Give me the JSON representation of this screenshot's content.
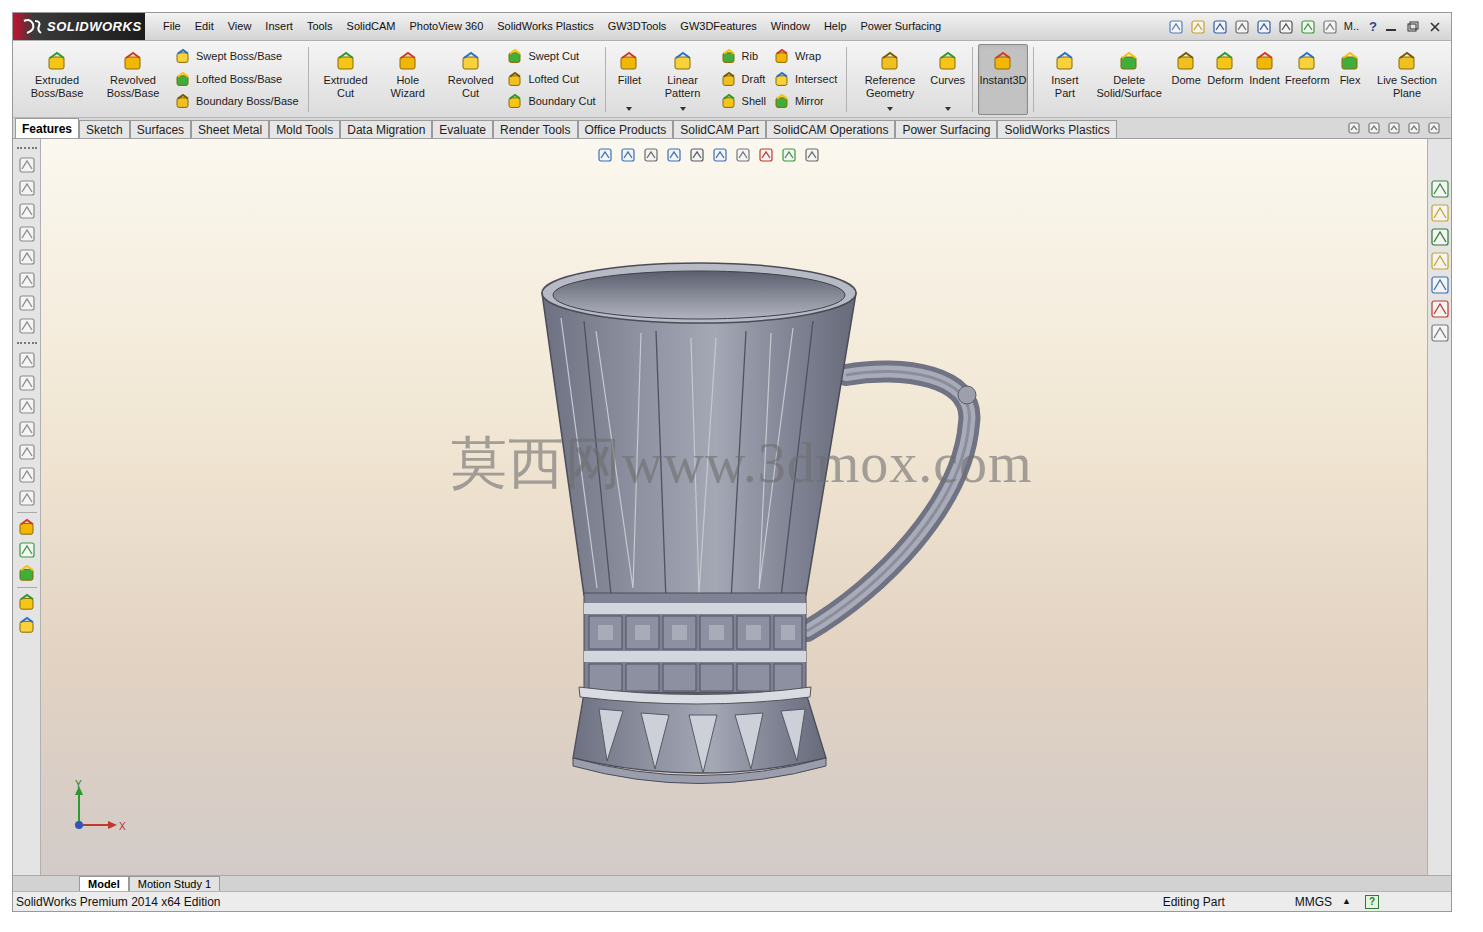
{
  "app": {
    "logo": "SOLIDWORKS"
  },
  "menu": [
    "File",
    "Edit",
    "View",
    "Insert",
    "Tools",
    "SolidCAM",
    "PhotoView 360",
    "SolidWorks Plastics",
    "GW3DTools",
    "GW3DFeatures",
    "Window",
    "Help",
    "Power Surfacing"
  ],
  "menu_right": {
    "user": "M..",
    "help": "?"
  },
  "ribbon": [
    {
      "kind": "large",
      "label": "Extruded Boss/Base",
      "selected": false,
      "dropdown": false
    },
    {
      "kind": "large",
      "label": "Revolved Boss/Base",
      "selected": false,
      "dropdown": false
    },
    {
      "kind": "stack",
      "items": [
        "Swept Boss/Base",
        "Lofted Boss/Base",
        "Boundary Boss/Base"
      ]
    },
    {
      "kind": "separator"
    },
    {
      "kind": "large",
      "label": "Extruded Cut",
      "selected": false,
      "dropdown": false
    },
    {
      "kind": "large",
      "label": "Hole Wizard",
      "selected": false,
      "dropdown": false
    },
    {
      "kind": "large",
      "label": "Revolved Cut",
      "selected": false,
      "dropdown": false
    },
    {
      "kind": "stack",
      "items": [
        "Swept Cut",
        "Lofted Cut",
        "Boundary Cut"
      ]
    },
    {
      "kind": "separator"
    },
    {
      "kind": "large",
      "label": "Fillet",
      "selected": false,
      "dropdown": true
    },
    {
      "kind": "large",
      "label": "Linear Pattern",
      "selected": false,
      "dropdown": true
    },
    {
      "kind": "stack",
      "items": [
        "Rib",
        "Draft",
        "Shell"
      ]
    },
    {
      "kind": "stack",
      "items": [
        "Wrap",
        "Intersect",
        "Mirror"
      ]
    },
    {
      "kind": "separator"
    },
    {
      "kind": "large",
      "label": "Reference Geometry",
      "selected": false,
      "dropdown": true
    },
    {
      "kind": "large",
      "label": "Curves",
      "selected": false,
      "dropdown": true
    },
    {
      "kind": "separator"
    },
    {
      "kind": "large",
      "label": "Instant3D",
      "selected": true,
      "dropdown": false
    },
    {
      "kind": "separator"
    },
    {
      "kind": "large",
      "label": "Insert Part",
      "selected": false,
      "dropdown": false
    },
    {
      "kind": "large",
      "label": "Delete Solid/Surface",
      "selected": false,
      "dropdown": false
    },
    {
      "kind": "large",
      "label": "Dome",
      "selected": false,
      "dropdown": false
    },
    {
      "kind": "large",
      "label": "Deform",
      "selected": false,
      "dropdown": false
    },
    {
      "kind": "large",
      "label": "Indent",
      "selected": false,
      "dropdown": false
    },
    {
      "kind": "large",
      "label": "Freeform",
      "selected": false,
      "dropdown": false
    },
    {
      "kind": "large",
      "label": "Flex",
      "selected": false,
      "dropdown": false
    },
    {
      "kind": "large",
      "label": "Live Section Plane",
      "selected": false,
      "dropdown": false
    }
  ],
  "tabs": [
    {
      "label": "Features",
      "selected": true
    },
    {
      "label": "Sketch",
      "selected": false
    },
    {
      "label": "Surfaces",
      "selected": false
    },
    {
      "label": "Sheet Metal",
      "selected": false
    },
    {
      "label": "Mold Tools",
      "selected": false
    },
    {
      "label": "Data Migration",
      "selected": false
    },
    {
      "label": "Evaluate",
      "selected": false
    },
    {
      "label": "Render Tools",
      "selected": false
    },
    {
      "label": "Office Products",
      "selected": false
    },
    {
      "label": "SolidCAM Part",
      "selected": false
    },
    {
      "label": "SolidCAM Operations",
      "selected": false
    },
    {
      "label": "Power Surfacing",
      "selected": false
    },
    {
      "label": "SolidWorks Plastics",
      "selected": false
    }
  ],
  "viewport": {
    "watermark": "莫西网www.3dmox.com",
    "axes": [
      "Y",
      "X"
    ]
  },
  "bottom_tabs": [
    {
      "label": "Model",
      "selected": true
    },
    {
      "label": "Motion Study 1",
      "selected": false
    }
  ],
  "status_bar": {
    "edition": "SolidWorks Premium 2014 x64 Edition",
    "mode": "Editing Part",
    "units": "MMGS",
    "units_arrow": "▲",
    "help": "?"
  }
}
